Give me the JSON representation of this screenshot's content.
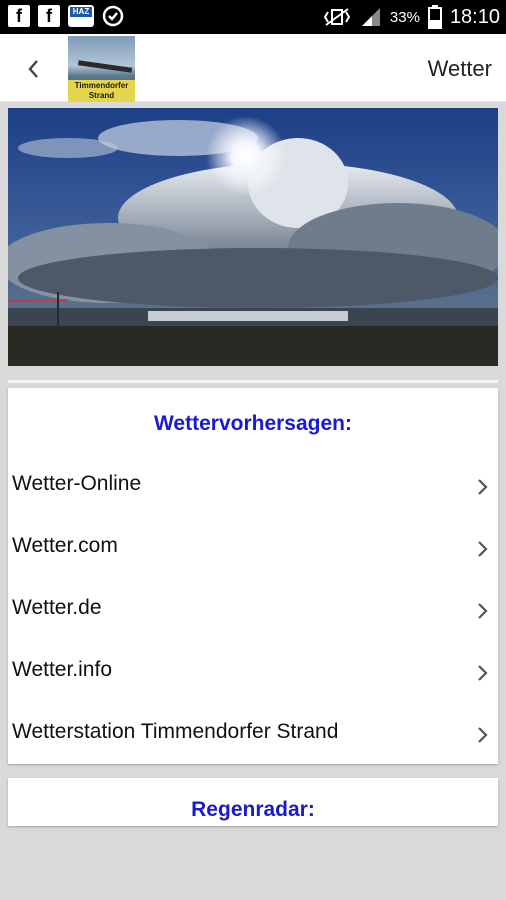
{
  "status_bar": {
    "icons": [
      "facebook-icon",
      "facebook-icon",
      "haz-app-icon",
      "sync-icon"
    ],
    "haz_label": "HAZ",
    "battery_percent": "33%",
    "time": "18:10"
  },
  "app_bar": {
    "logo_text": "Timmendorfer Strand",
    "title": "Wetter"
  },
  "forecasts": {
    "heading": "Wettervorhersagen:",
    "items": [
      {
        "label": "Wetter-Online"
      },
      {
        "label": "Wetter.com"
      },
      {
        "label": "Wetter.de"
      },
      {
        "label": "Wetter.info"
      },
      {
        "label": "Wetterstation Timmendorfer Strand"
      }
    ]
  },
  "radar": {
    "heading": "Regenradar:"
  },
  "colors": {
    "heading_blue": "#1a1ad0",
    "background": "#d9d9d9"
  }
}
